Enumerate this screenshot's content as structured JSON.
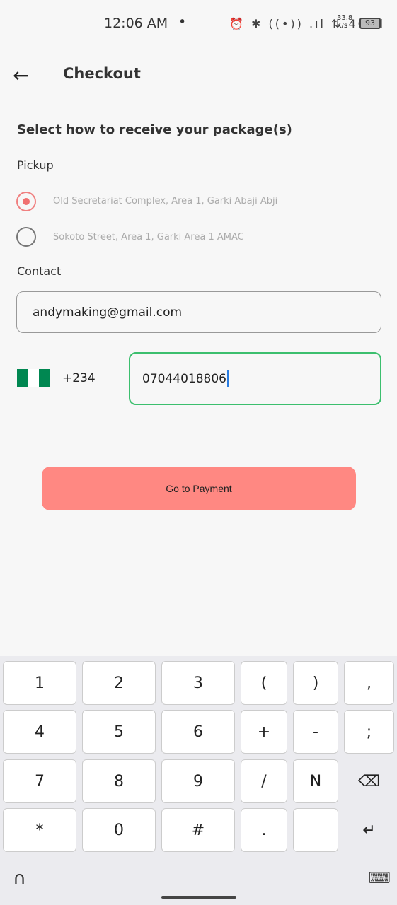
{
  "status": {
    "time": "12:06 AM",
    "dot": "•",
    "icons": "⏰ ✱ ((•)) .ıl ⇅ 4G.ıl",
    "speed": "33.8 K/s",
    "battery": "93"
  },
  "header": {
    "back_icon": "←",
    "title": "Checkout"
  },
  "delivery": {
    "heading": "Select how to receive your package(s)",
    "pickup_label": "Pickup",
    "options": [
      {
        "label": "Old Secretariat Complex, Area 1, Garki Abaji Abji",
        "selected": true
      },
      {
        "label": "Sokoto Street, Area 1, Garki Area 1 AMAC",
        "selected": false
      }
    ]
  },
  "contact": {
    "label": "Contact",
    "email": "andymaking@gmail.com",
    "country_code": "+234",
    "phone": "07044018806"
  },
  "colors": {
    "accent": "#ff8882",
    "focus": "#3cbf6e",
    "flag_green": "#008751"
  },
  "pay_button": "Go to Payment",
  "keyboard": {
    "rows": [
      [
        "1",
        "2",
        "3",
        "(",
        ")",
        ","
      ],
      [
        "4",
        "5",
        "6",
        "+",
        "-",
        ";"
      ],
      [
        "7",
        "8",
        "9",
        "/",
        "N",
        "⌫"
      ],
      [
        "*",
        "0",
        "#",
        ".",
        " ",
        "↵"
      ]
    ],
    "left_icon": "∩",
    "right_icon": "⌨"
  }
}
